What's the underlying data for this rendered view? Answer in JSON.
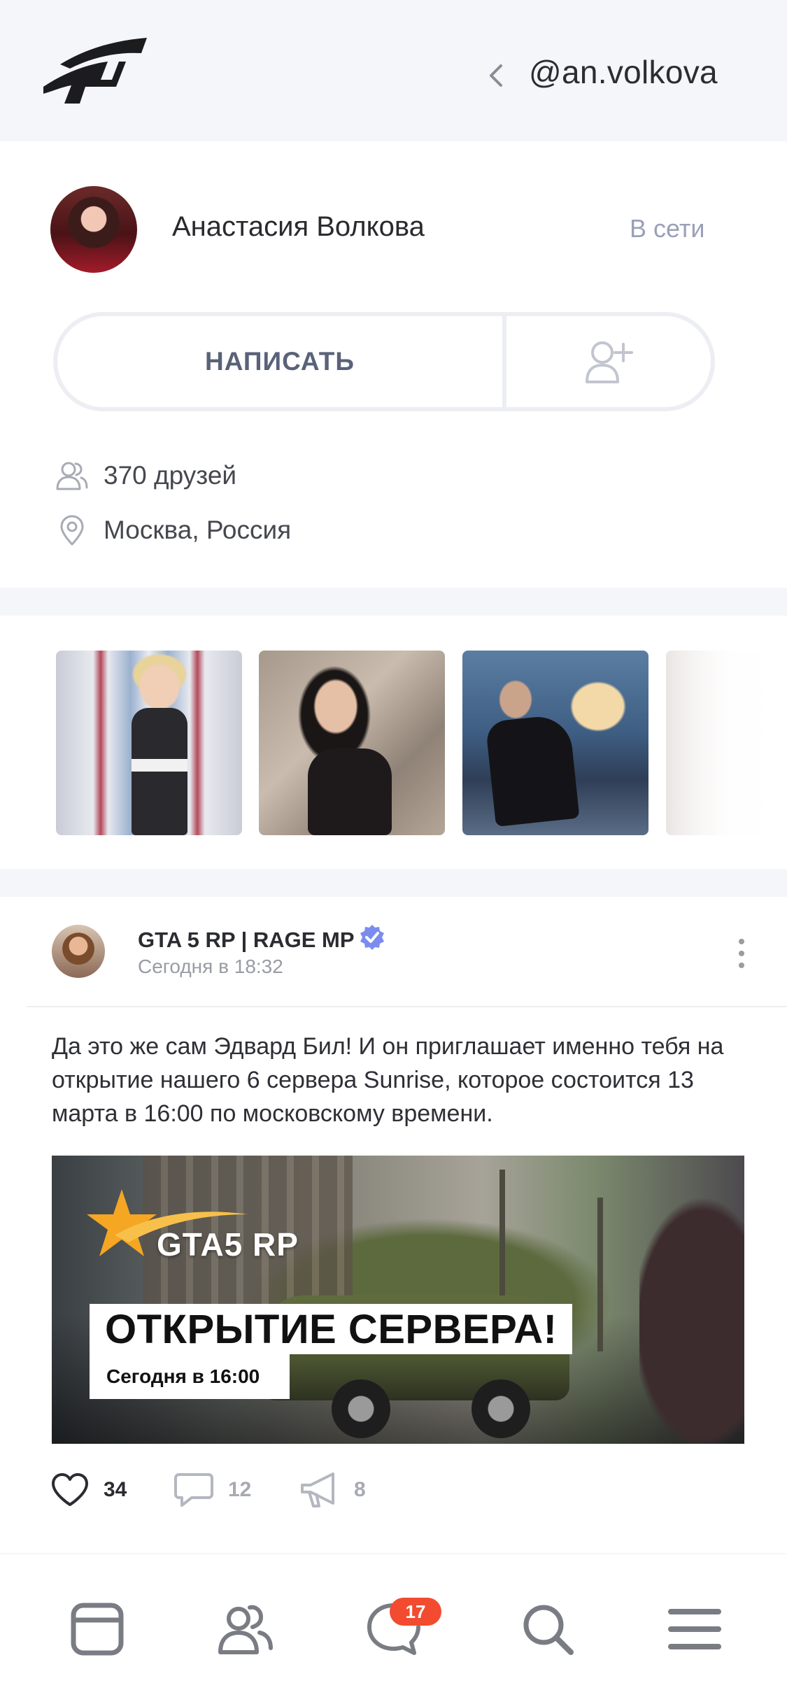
{
  "header": {
    "username": "@an.volkova"
  },
  "profile": {
    "name": "Анастасия Волкова",
    "status": "В сети",
    "write_button": "НАПИСАТЬ",
    "friends": "370 друзей",
    "location": "Москва, Россия"
  },
  "post": {
    "author": "GTA 5 RP | RAGE MP",
    "time": "Сегодня в 18:32",
    "text": "Да это же сам Эдвард Бил! И он приглашает именно тебя на открытие нашего 6 сервера Sunrise, которое состоится 13 марта в 16:00 по московскому времени.",
    "banner": {
      "logo_text": "GTA5 RP",
      "title": "ОТКРЫТИЕ СЕРВЕРА!",
      "subtitle": "Сегодня в 16:00"
    },
    "likes": "34",
    "comments": "12",
    "shares": "8"
  },
  "tabbar": {
    "messages_badge": "17"
  },
  "colors": {
    "accent_verified": "#7b8cf0",
    "badge": "#f24b30",
    "muted": "#9aa0b8"
  },
  "icons": {
    "logo": "brand-logo-icon",
    "back": "chevron-left-icon",
    "add_friend": "add-friend-icon",
    "friends": "friends-icon",
    "location": "location-pin-icon",
    "verified": "verified-badge-icon",
    "more": "more-vertical-icon",
    "like": "heart-icon",
    "comment": "comment-icon",
    "share": "megaphone-icon",
    "tab_feed": "feed-icon",
    "tab_friends": "friends-tab-icon",
    "tab_messages": "messages-icon",
    "tab_search": "search-icon",
    "tab_menu": "menu-icon"
  }
}
